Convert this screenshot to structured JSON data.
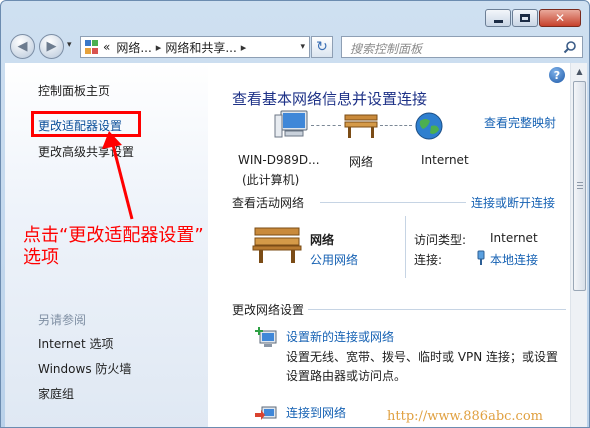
{
  "titlebar": {
    "minimize_label": "",
    "maximize_label": "",
    "close_label": "✕"
  },
  "navbar": {
    "back_glyph": "◀",
    "forward_glyph": "▶",
    "address": {
      "crumb_prefix": "«",
      "crumb_1": "网络...",
      "separator": "▸",
      "crumb_2": "网络和共享...",
      "separator_2": "▸"
    },
    "refresh_glyph": "↻",
    "search_placeholder": "搜索控制面板"
  },
  "sidebar": {
    "home": "控制面板主页",
    "links": [
      {
        "label": "更改适配器设置"
      },
      {
        "label": "更改高级共享设置"
      }
    ],
    "see_also_title": "另请参阅",
    "see_also": [
      {
        "label": "Internet 选项"
      },
      {
        "label": "Windows 防火墙"
      },
      {
        "label": "家庭组"
      }
    ]
  },
  "main": {
    "title": "查看基本网络信息并设置连接",
    "see_full_map": "查看完整映射",
    "nodes": {
      "computer_name": "WIN-D989D...",
      "computer_sub": "(此计算机)",
      "network": "网络",
      "internet": "Internet"
    },
    "active": {
      "heading": "查看活动网络",
      "connect_link": "连接或断开连接",
      "name": "网络",
      "type": "公用网络",
      "access_type_label": "访问类型:",
      "access_type_value": "Internet",
      "connection_label": "连接:",
      "connection_value": "本地连接"
    },
    "change": {
      "heading": "更改网络设置",
      "tasks": [
        {
          "link": "设置新的连接或网络",
          "desc_1": "设置无线、宽带、拨号、临时或 VPN 连接；或设置",
          "desc_2": "设置路由器或访问点。"
        },
        {
          "link": "连接到网络"
        }
      ]
    }
  },
  "annotation": {
    "line_1": "点击“更改适配器设置”",
    "line_2": "选项"
  },
  "watermark": "http://www.886abc.com",
  "colors": {
    "link": "#1561b3",
    "title": "#1e3287",
    "annotation": "#ff0000",
    "window_chrome": "#b9d1ea"
  },
  "icons": {
    "computer": "computer-icon",
    "bench": "bench-network-icon",
    "globe": "globe-icon",
    "help": "help-icon",
    "search": "search-icon",
    "connection": "network-plug-icon",
    "new_connection": "new-connection-icon",
    "connect_network": "connect-network-icon"
  }
}
